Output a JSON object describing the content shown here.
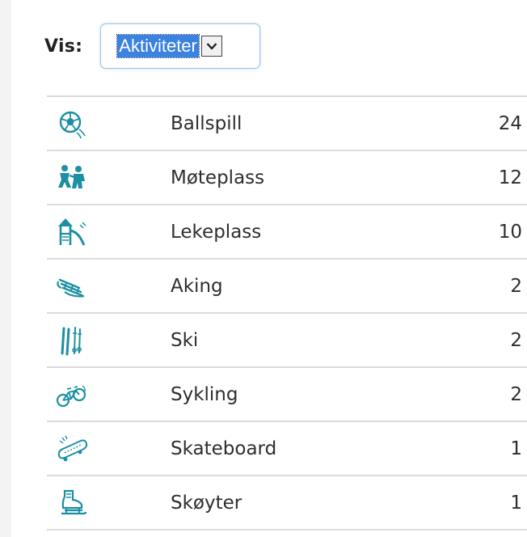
{
  "filter": {
    "label": "Vis:",
    "selected": "Aktiviteter"
  },
  "activities": [
    {
      "label": "Ballspill",
      "count": "24",
      "icon": "soccer-ball-icon"
    },
    {
      "label": "Møteplass",
      "count": "12",
      "icon": "meeting-place-icon"
    },
    {
      "label": "Lekeplass",
      "count": "10",
      "icon": "playground-icon"
    },
    {
      "label": "Aking",
      "count": "2",
      "icon": "sled-icon"
    },
    {
      "label": "Ski",
      "count": "2",
      "icon": "ski-icon"
    },
    {
      "label": "Sykling",
      "count": "2",
      "icon": "bicycle-icon"
    },
    {
      "label": "Skateboard",
      "count": "1",
      "icon": "skateboard-icon"
    },
    {
      "label": "Skøyter",
      "count": "1",
      "icon": "ice-skate-icon"
    }
  ],
  "colors": {
    "icon_teal": "#1c8fa3",
    "select_highlight": "#3c82e0",
    "divider": "#dcdcdc"
  }
}
